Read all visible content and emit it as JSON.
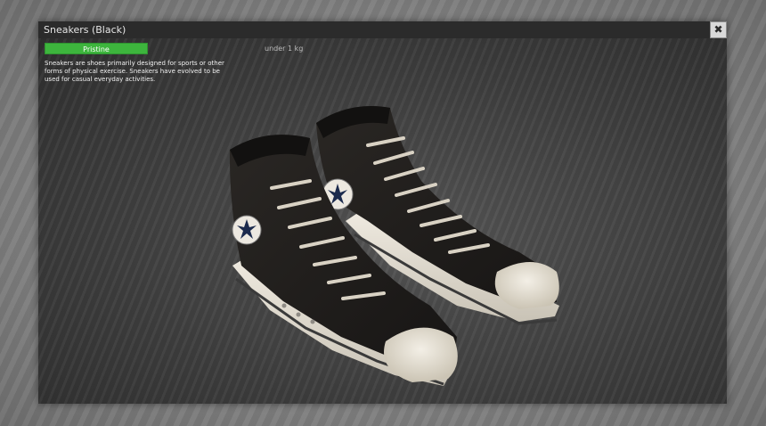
{
  "window": {
    "title": "Sneakers (Black)",
    "close_icon": "close-icon"
  },
  "item": {
    "condition": "Pristine",
    "condition_color": "#3db53d",
    "weight": "under 1 kg",
    "description": "Sneakers are shoes primarily designed for sports or other forms of physical exercise. Sneakers have evolved to be used for casual everyday activities."
  },
  "preview": {
    "subject": "pair of black high-top canvas sneakers with white rubber toe caps and laces",
    "shoe_color": "#1f1c1a",
    "sole_color": "#e8e3d8",
    "lace_color": "#d9d2c4"
  }
}
